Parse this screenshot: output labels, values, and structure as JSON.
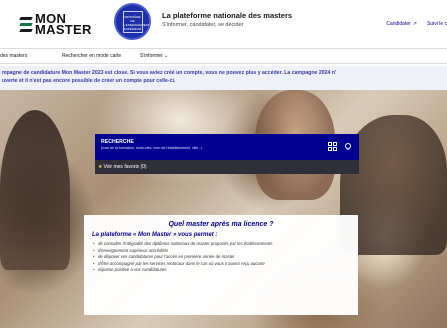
{
  "header": {
    "logo_line1": "MON",
    "logo_line2": "MASTER",
    "emblem_text": "MINISTÈRE DE L'ENSEIGNEMENT SUPÉRIEUR",
    "title": "La plateforme nationale des masters",
    "subtitle": "S'informer, candidater, se décider",
    "links": [
      {
        "label": "Candidater",
        "icon": "external-link-icon"
      },
      {
        "label": "Suivi le c",
        "icon": ""
      }
    ]
  },
  "nav": {
    "items": [
      {
        "label": "des masters"
      },
      {
        "label": "Rechercher en mode carte"
      },
      {
        "label": "S'informer",
        "icon": "chevron-down-icon"
      }
    ]
  },
  "notice": {
    "line1": "mpagne de candidature Mon Master 2023 est close. Si vous aviez créé un compte, vous ne pouvez plus y accéder. La campagne 2024 n'",
    "line2": "uverte et il n'est pas encore possible de créer un compte pour celle-ci."
  },
  "search": {
    "label": "RECHERCHE",
    "placeholder": "(nom de la formation, mots-clés, nom de l'établissement, ville...)",
    "favorites": "Voir mes favoris (0)",
    "favorites_icon": "star-icon",
    "buttons": [
      "grid-icon",
      "map-pin-icon"
    ]
  },
  "card": {
    "title": "Quel master après ma licence ?",
    "intro": "La plateforme « Mon Master » vous permet :",
    "items": [
      "de consulter l'intégralité des diplômes nationaux de master proposés par les établissements",
      "d'enseignement supérieur accrédités",
      "de déposer vos candidatures pour l'accès en première année de master",
      "d'être accompagné par les services rectoraux dans le cas où vous n'auriez reçu aucune",
      "réponse positive à vos candidatures"
    ]
  },
  "colors": {
    "primary": "#000091",
    "brand_green": "#0b7a3e",
    "notice_bg": "#eef1f8"
  }
}
